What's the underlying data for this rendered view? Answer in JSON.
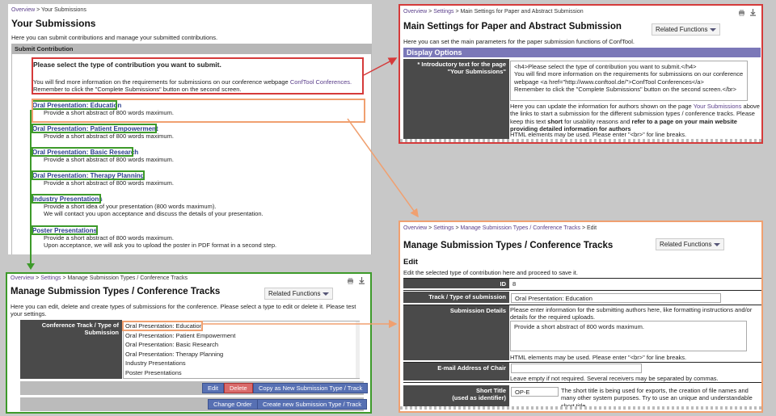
{
  "panel1": {
    "breadcrumb_overview": "Overview",
    "breadcrumb_current": "> Your Submissions",
    "title": "Your Submissions",
    "intro": "Here you can submit contributions and manage your submitted contributions.",
    "section_header": "Submit Contribution",
    "select_heading": "Please select the type of contribution you want to submit.",
    "info_line1_prefix": "You will find more information on the requirements for submissions on our conference webpage",
    "info_link": "ConfTool Conferences.",
    "info_line2": "Remember to click the \"Complete Submissions\" button on the second screen.",
    "types": [
      {
        "title": "Oral Presentation: Education",
        "desc": "Provide a short abstract of 800 words maximum."
      },
      {
        "title": "Oral Presentation: Patient Empowerment",
        "desc": "Provide a short abstract of 800 words maximum."
      },
      {
        "title": "Oral Presentation: Basic Research",
        "desc": "Provide a short abstract of 800 words maximum."
      },
      {
        "title": "Oral Presentation: Therapy Planning",
        "desc": "Provide a short abstract of 800 words maximum."
      },
      {
        "title": "Industry Presentations",
        "desc": "Provide a short idea of your presentation (800 words maximum).",
        "desc2": "We will contact you upon acceptance and discuss the details of your presentation."
      },
      {
        "title": "Poster Presentations",
        "desc": "Provide a short abstract of 800 words maximum.",
        "desc2": "Upon acceptance, we will ask you to upload the poster in PDF format in a second step."
      }
    ]
  },
  "panel2": {
    "breadcrumb_overview": "Overview",
    "breadcrumb_sep": ">",
    "breadcrumb_settings": "Settings",
    "breadcrumb_current": "> Main Settings for Paper and Abstract Submission",
    "title": "Main Settings for Paper and Abstract Submission",
    "related_functions": "Related Functions",
    "intro": "Here you can set the main parameters for the paper submission functions of ConfTool.",
    "display_options": "Display Options",
    "label": "* Introductory text for the page \"Your Submissions\"",
    "textarea_lines": [
      "<h4>Please select the type of contribution you want to submit.</h4>",
      "You will find more information on the requirements for submissions on our conference",
      "webpage <a href=\"http://www.conftool.de/\">ConfTool Conferences</a>",
      "Remember to click the \"Complete Submissions\" button on the second screen.</br>"
    ],
    "help_prefix": "Here you can update the information for authors shown on the page",
    "help_link": "Your Submissions",
    "help_suffix": "above the links to start a submission for the different submission types / conference tracks. Please keep this text",
    "help_short": "short",
    "help_mid": "for usability reasons and",
    "help_bold": "refer to a page on your main website providing detailed information for authors",
    "help_html": "HTML elements may be used. Please enter \"<br>\" for line breaks."
  },
  "panel3": {
    "breadcrumb_overview": "Overview",
    "breadcrumb_sep": ">",
    "breadcrumb_settings": "Settings",
    "breadcrumb_current": "> Manage Submission Types / Conference Tracks",
    "title": "Manage Submission Types / Conference Tracks",
    "related_functions": "Related Functions",
    "intro": "Here you can edit, delete and create types of submissions for the conference. Please select a type to edit or delete it. Please test your settings.",
    "label": "Conference Track / Type of Submission",
    "options": [
      "Oral Presentation: Education",
      "Oral Presentation: Patient Empowerment",
      "Oral Presentation: Basic Research",
      "Oral Presentation: Therapy Planning",
      "Industry Presentations",
      "Poster Presentations"
    ],
    "btn_edit": "Edit",
    "btn_delete": "Delete",
    "btn_copy": "Copy as New Submission Type / Track",
    "btn_change_order": "Change Order",
    "btn_create": "Create new Submission Type / Track"
  },
  "panel4": {
    "breadcrumb_overview": "Overview",
    "breadcrumb_sep": ">",
    "breadcrumb_settings": "Settings",
    "breadcrumb_manage": "Manage Submission Types / Conference Tracks",
    "breadcrumb_current": "> Edit",
    "title": "Manage Submission Types / Conference Tracks",
    "related_functions": "Related Functions",
    "subtitle": "Edit",
    "intro": "Edit the selected type of contribution here and proceed to save it.",
    "id_label": "ID",
    "id_value": "8",
    "track_label": "Track / Type of submission",
    "track_value": "Oral Presentation: Education",
    "details_label": "Submission Details",
    "details_help": "Please enter information for the submitting authors here, like formatting instructions and/or details for the required uploads.",
    "details_value": "Provide a short abstract of 800 words maximum.",
    "details_html": "HTML elements may be used. Please enter \"<br>\" for line breaks.",
    "email_label": "E-mail Address of Chair",
    "email_help": "Leave empty if not required. Several receivers may be separated by commas.",
    "short_label": "Short Title",
    "short_label2": "(used as identifier)",
    "short_value": "OP-E",
    "short_help": "The short title is being used for exports, the creation of file names and many other system purposes. Try to use an unique and understandable short title."
  }
}
